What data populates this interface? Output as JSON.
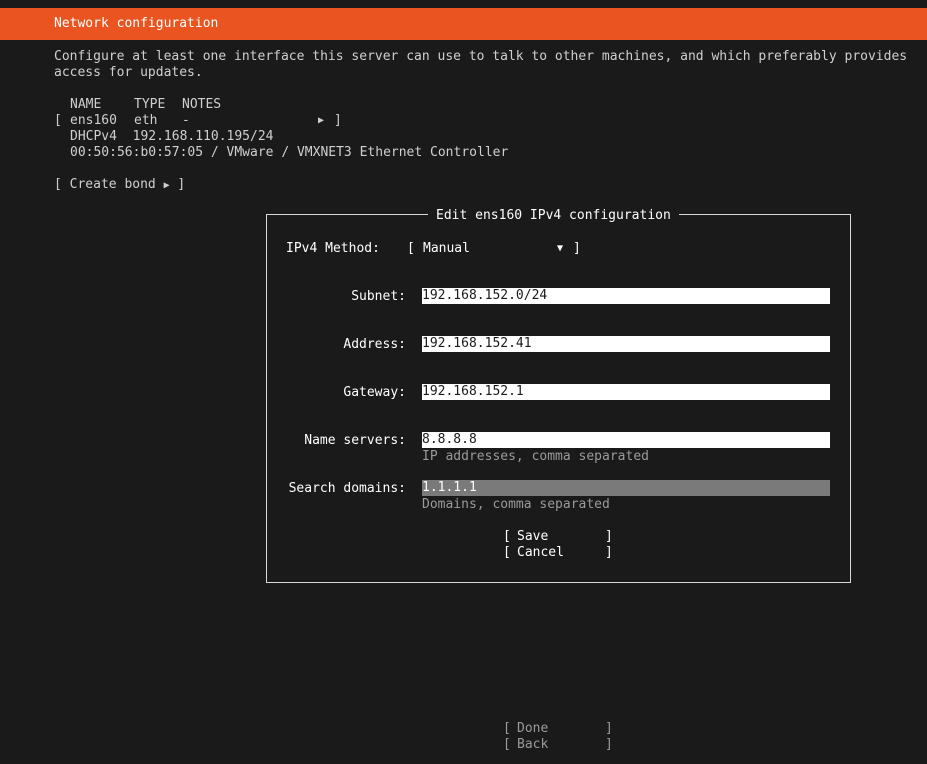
{
  "header": {
    "title": "Network configuration"
  },
  "intro": {
    "line1": "Configure at least one interface this server can use to talk to other machines, and which preferably provides",
    "line2": "access for updates."
  },
  "interfaces": {
    "columns": [
      "NAME",
      "TYPE",
      "NOTES"
    ],
    "rows": [
      {
        "name": "ens160",
        "type": "eth",
        "notes": "-"
      }
    ],
    "details": [
      "DHCPv4  192.168.110.195/24",
      "00:50:56:b0:57:05 / VMware / VMXNET3 Ethernet Controller"
    ]
  },
  "create_bond_label": "Create bond",
  "dialog": {
    "title": "Edit ens160 IPv4 configuration",
    "method_label": "IPv4 Method:",
    "method_value": "Manual",
    "subnet_label": "Subnet:",
    "subnet_value": "192.168.152.0/24",
    "address_label": "Address:",
    "address_value": "192.168.152.41",
    "gateway_label": "Gateway:",
    "gateway_value": "192.168.152.1",
    "nameservers_label": "Name servers:",
    "nameservers_value": "8.8.8.8",
    "nameservers_hint": "IP addresses, comma separated",
    "searchdomains_label": "Search domains:",
    "searchdomains_value": "1.1.1.1",
    "searchdomains_hint": "Domains, comma separated",
    "save_label": "Save",
    "cancel_label": "Cancel"
  },
  "footer": {
    "done_label": "Done",
    "back_label": "Back"
  }
}
